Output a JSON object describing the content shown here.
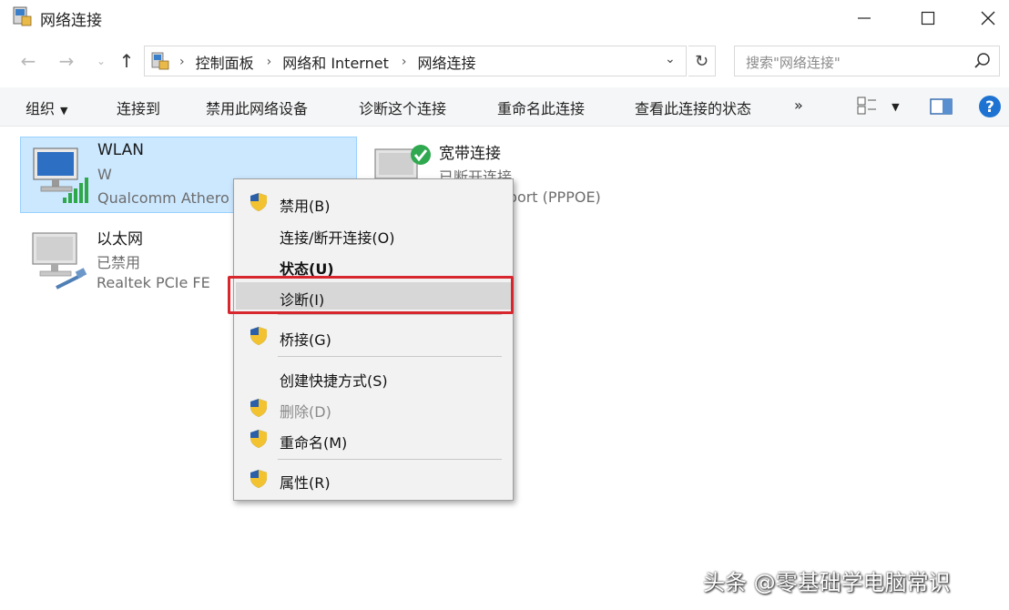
{
  "window": {
    "title": "网络连接"
  },
  "nav": {
    "breadcrumbs": [
      "控制面板",
      "网络和 Internet",
      "网络连接"
    ],
    "search_placeholder": "搜索\"网络连接\""
  },
  "toolbar": {
    "items": [
      "组织",
      "连接到",
      "禁用此网络设备",
      "诊断这个连接",
      "重命名此连接",
      "查看此连接的状态"
    ],
    "more": "»"
  },
  "connections": [
    {
      "name": "WLAN",
      "status": "W",
      "device": "Qualcomm Athero",
      "selected": true
    },
    {
      "name": "宽带连接",
      "status": "已断开连接",
      "device": "WAN Miniport (PPPOE)",
      "selected": false
    },
    {
      "name": "以太网",
      "status": "已禁用",
      "device": "Realtek PCIe FE",
      "selected": false
    }
  ],
  "context_menu": {
    "items": [
      {
        "label": "禁用(B)",
        "shield": true,
        "bold": false,
        "disabled": false
      },
      {
        "label": "连接/断开连接(O)",
        "shield": false,
        "bold": false,
        "disabled": false
      },
      {
        "label": "状态(U)",
        "shield": false,
        "bold": true,
        "disabled": false
      },
      {
        "label": "诊断(I)",
        "shield": false,
        "bold": false,
        "disabled": false,
        "highlighted": true
      },
      {
        "label": "桥接(G)",
        "shield": true,
        "bold": false,
        "disabled": false
      },
      {
        "label": "创建快捷方式(S)",
        "shield": false,
        "bold": false,
        "disabled": false
      },
      {
        "label": "删除(D)",
        "shield": true,
        "bold": false,
        "disabled": true
      },
      {
        "label": "重命名(M)",
        "shield": true,
        "bold": false,
        "disabled": false
      },
      {
        "label": "属性(R)",
        "shield": true,
        "bold": false,
        "disabled": false
      }
    ]
  },
  "watermark": "头条 @零基础学电脑常识",
  "colors": {
    "selection_bg": "#cce8ff",
    "selection_border": "#99d1ff",
    "highlight_box": "#d7262d",
    "help_blue": "#1e73d2",
    "signal_green": "#2ea84a"
  }
}
